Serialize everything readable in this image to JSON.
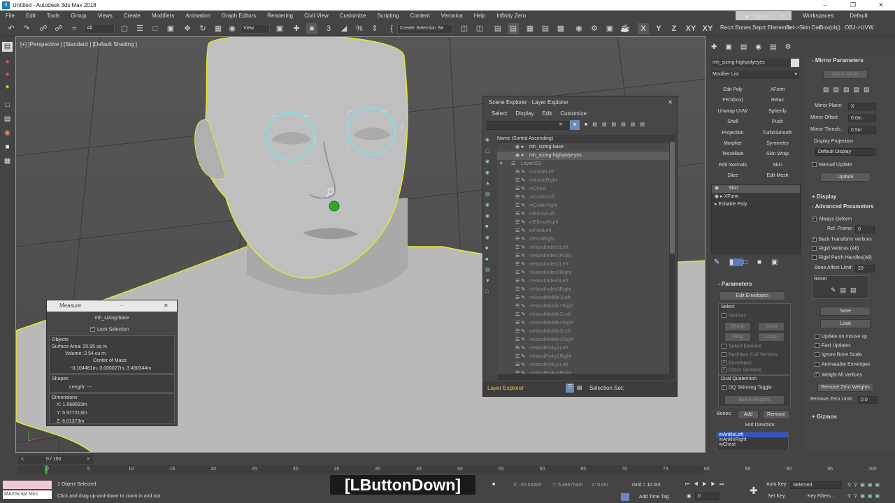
{
  "title_bar": {
    "title": "Untitled - Autodesk 3ds Max 2018"
  },
  "menu": [
    "File",
    "Edit",
    "Tools",
    "Group",
    "Views",
    "Create",
    "Modifiers",
    "Animation",
    "Graph Editors",
    "Rendering",
    "Civil View",
    "Customize",
    "Scripting",
    "Content",
    "Veronica",
    "Help",
    "Infinity Zero"
  ],
  "signin": "Sign In",
  "workspaces": {
    "label": "Workspaces:",
    "value": "Default"
  },
  "toolbar": {
    "selection_filter": "All",
    "view_dropdown": "View",
    "create_selection_set": "Create Selection Se",
    "axis_labels": [
      "X",
      "Y",
      "Z",
      "XY",
      "XY"
    ],
    "custom_buttons": [
      "Recrt Bones",
      "Seprt Elements",
      "Sel->Skin Dat",
      "Box(obj)",
      "OBJ->UVW"
    ]
  },
  "viewport": {
    "label": "[+] [Perspective ] [Standard ] [Default Shading ]"
  },
  "measure": {
    "title": "Measure",
    "object_name": "mh_sizing-base",
    "lock_selection": "Lock Selection",
    "objects_label": "Objects",
    "surface_area": "Surface Area: 20.95 sq m",
    "volume": "Volume:  2.54 cu m",
    "center_of_mass_label": "Center of Mass:",
    "center_of_mass": "-0.104481m, 0.000027m, 3.450344m",
    "shapes_label": "Shapes",
    "length": "Length:  ---",
    "dimensions_label": "Dimensions",
    "dim_x": "X:  1.068693m",
    "dim_y": "Y:  5.977213m",
    "dim_z": "Z:  6.01373m"
  },
  "scene_explorer": {
    "title": "Scene Explorer - Layer Explorer",
    "menu": [
      "Select",
      "Display",
      "Edit",
      "Customize"
    ],
    "column_header": "Name (Sorted Ascending)",
    "top_items": [
      "mh_sizing-base",
      "mh_sizing-highpolyeyes"
    ],
    "layer": "Layer002",
    "bones": [
      "mAnkleLeft",
      "mAnkleRight",
      "mChest",
      "mCollarLeft",
      "mCollarRight",
      "mElbowLeft",
      "mElbowRight",
      "mFootLeft",
      "mFootRight",
      "mHandIndex1Left",
      "mHandIndex1Right",
      "mHandIndex2Left",
      "mHandIndex2Right",
      "mHandIndex3Left",
      "mHandIndex3Right",
      "mHandMiddle1Left",
      "mHandMiddle1Right",
      "mHandMiddle2Left",
      "mHandMiddle2Right",
      "mHandMiddle3Left",
      "mHandMiddle3Right",
      "mHandPinky1Left",
      "mHandPinky1Right",
      "mHandPinky2Left",
      "mHandPinky2Right"
    ],
    "footer_label": "Layer Explorer",
    "selection_set": "Selection Set:"
  },
  "command_panel": {
    "object_name": "mh_sizing-highpolyeyes",
    "modifier_list": "Modifier List",
    "modifier_buttons": [
      "Edit Poly",
      "XForm",
      "FFD(box)",
      "Relax",
      "Unwrap UVW",
      "Spherify",
      "Shell",
      "Push",
      "Projection",
      "TurboSmooth",
      "Morpher",
      "Symmetry",
      "Tessellate",
      "Skin Wrap",
      "Edit Normals",
      "Skin",
      "Slice",
      "Edit Mesh"
    ],
    "stack": [
      "Skin",
      "XForm",
      "Editable Poly"
    ],
    "parameters": {
      "title": "Parameters",
      "edit_envelopes": "Edit Envelopes",
      "select_label": "Select",
      "vertices": "Vertices",
      "shrink": "Shrink",
      "grow": "Grow",
      "ring": "Ring",
      "loop": "Loop",
      "select_element": "Select Element",
      "backface": "Backface Cull Vertices",
      "envelopes": "Envelopes",
      "cross_sections": "Cross Sections",
      "dual_quaternion": "Dual Quaternion",
      "dq_toggle": "DQ Skinning Toggle",
      "blend_weights": "Blend Weights",
      "bones_label": "Bones:",
      "add": "Add",
      "remove": "Remove",
      "sort_direction": "Sort Direction:",
      "bone_list": [
        "mAnkleLeft",
        "mAnkleRight",
        "mChest"
      ]
    },
    "mirror": {
      "title": "Mirror Parameters",
      "mirror_mode": "Mirror Mode",
      "plane_label": "Mirror Plane:",
      "plane": "X",
      "offset_label": "Mirror Offset:",
      "offset": "0.0m",
      "thresh_label": "Mirror Thresh.:",
      "thresh": "0.5m",
      "display_projection": "Display Projection",
      "projection_value": "Default Display",
      "manual_update": "Manual Update",
      "update": "Update"
    },
    "display_title": "Display",
    "advanced": {
      "title": "Advanced Parameters",
      "always_deform": "Always Deform",
      "ref_frame_label": "Ref. Frame:",
      "ref_frame": "0",
      "back_transform": "Back Transform Vertices",
      "rigid_vertices": "Rigid Vertices (All)",
      "rigid_patch": "Rigid Patch Handles(All)",
      "bone_affect_label": "Bone Affect Limit:",
      "bone_affect": "20",
      "reset": "Reset",
      "save": "Save",
      "load": "Load",
      "update_on_mouse_up": "Update on mouse up",
      "fast_updates": "Fast Updates",
      "ignore_bone_scale": "Ignore Bone Scale",
      "animatable_envelopes": "Animatable Envelopes",
      "weight_all_vertices": "Weight All Vertices",
      "remove_zero_weights": "Remove Zero Weights",
      "remove_zero_limit_label": "Remove Zero Limit:",
      "remove_zero_limit": "0.0"
    },
    "gizmos": "Gizmos"
  },
  "timeline": {
    "frame": "0 / 100",
    "ticks": [
      "0",
      "5",
      "10",
      "15",
      "20",
      "25",
      "30",
      "35",
      "40",
      "45",
      "50",
      "55",
      "60",
      "65",
      "70",
      "75",
      "80",
      "85",
      "90",
      "95",
      "100"
    ]
  },
  "status": {
    "maxscript": "MAXScript Mini",
    "selected": "1 Object Selected",
    "prompt": "Click and drag up-and-down to zoom in and out",
    "x": "X: -20.54320",
    "y": "Y: 5.469754m",
    "z": "Z: 0.0m",
    "grid": "Grid = 10.0m",
    "add_time_tag": "Add Time Tag",
    "auto_key": "Auto Key",
    "set_key": "Set Key",
    "selected_dd": "Selected",
    "key_filters": "Key Filters...",
    "frame_field": "0"
  },
  "overlay": "[LButtonDown]"
}
